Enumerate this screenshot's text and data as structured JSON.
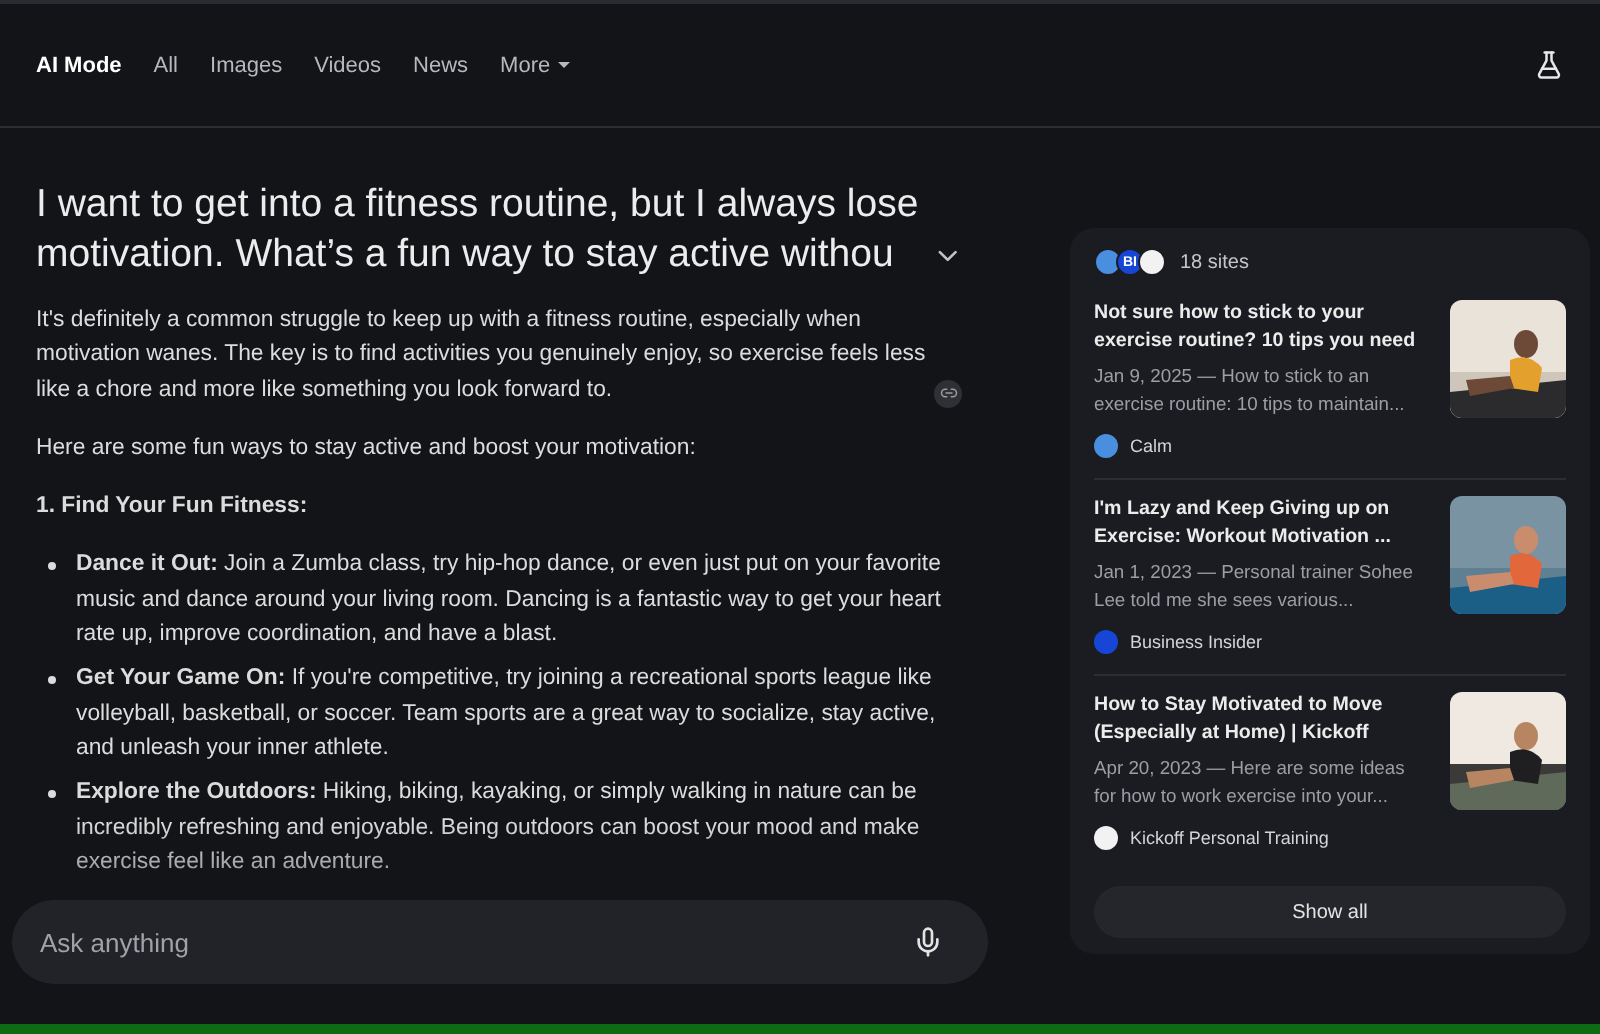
{
  "nav": {
    "tabs": [
      {
        "label": "AI Mode",
        "selected": true
      },
      {
        "label": "All",
        "selected": false
      },
      {
        "label": "Images",
        "selected": false
      },
      {
        "label": "Videos",
        "selected": false
      },
      {
        "label": "News",
        "selected": false
      }
    ],
    "more": "More"
  },
  "question": "I want to get into a fitness routine, but I always lose motivation. What’s a fun way to stay active withou",
  "answer": {
    "intro": "It's definitely a common struggle to keep up with a fitness routine, especially when motivation wanes. The key is to find activities you genuinely enjoy, so exercise feels less like a chore and more like something you look forward to.",
    "lead": "Here are some fun ways to stay active and boost your motivation:",
    "heading": "1. Find Your Fun Fitness:",
    "bullets": [
      {
        "text": "**Dance it Out:** Join a Zumba class, try hip-hop dance, or even just put on your favorite music and dance around your living room. Dancing is a fantastic way to get your heart rate up, improve coordination, and have a blast."
      },
      {
        "text": "**Get Your Game On:** If you're competitive, try joining a recreational sports league like volleyball, basketball, or soccer. Team sports are a great way to socialize, stay active, and unleash your inner athlete."
      },
      {
        "text": "**Explore the Outdoors:** Hiking, biking, kayaking, or simply walking in nature can be incredibly refreshing and enjoyable. Being outdoors can boost your mood and make exercise feel like an adventure."
      }
    ]
  },
  "search": {
    "placeholder": "Ask anything"
  },
  "sources": {
    "count": "18 sites",
    "badges": [
      {
        "color": "#4a8ee0"
      },
      {
        "color": "#1746d6",
        "label": "BI"
      },
      {
        "color": "#f2f2f2"
      }
    ],
    "items": [
      {
        "title": "Not sure how to stick to your exercise routine? 10 tips you need",
        "snippet": "Jan 9, 2025 — How to stick to an exercise routine: 10 tips to maintain...",
        "site": "Calm",
        "color": "#4a8ee0"
      },
      {
        "title": "I'm Lazy and Keep Giving up on Exercise: Workout Motivation ...",
        "snippet": "Jan 1, 2023 — Personal trainer Sohee Lee told me she sees various...",
        "site": "Business Insider",
        "color": "#1746d6"
      },
      {
        "title": "How to Stay Motivated to Move (Especially at Home) | Kickoff",
        "snippet": "Apr 20, 2023 — Here are some ideas for how to work exercise into your...",
        "site": "Kickoff Personal Training",
        "color": "#f2f2f2"
      }
    ],
    "show_all": "Show all"
  }
}
